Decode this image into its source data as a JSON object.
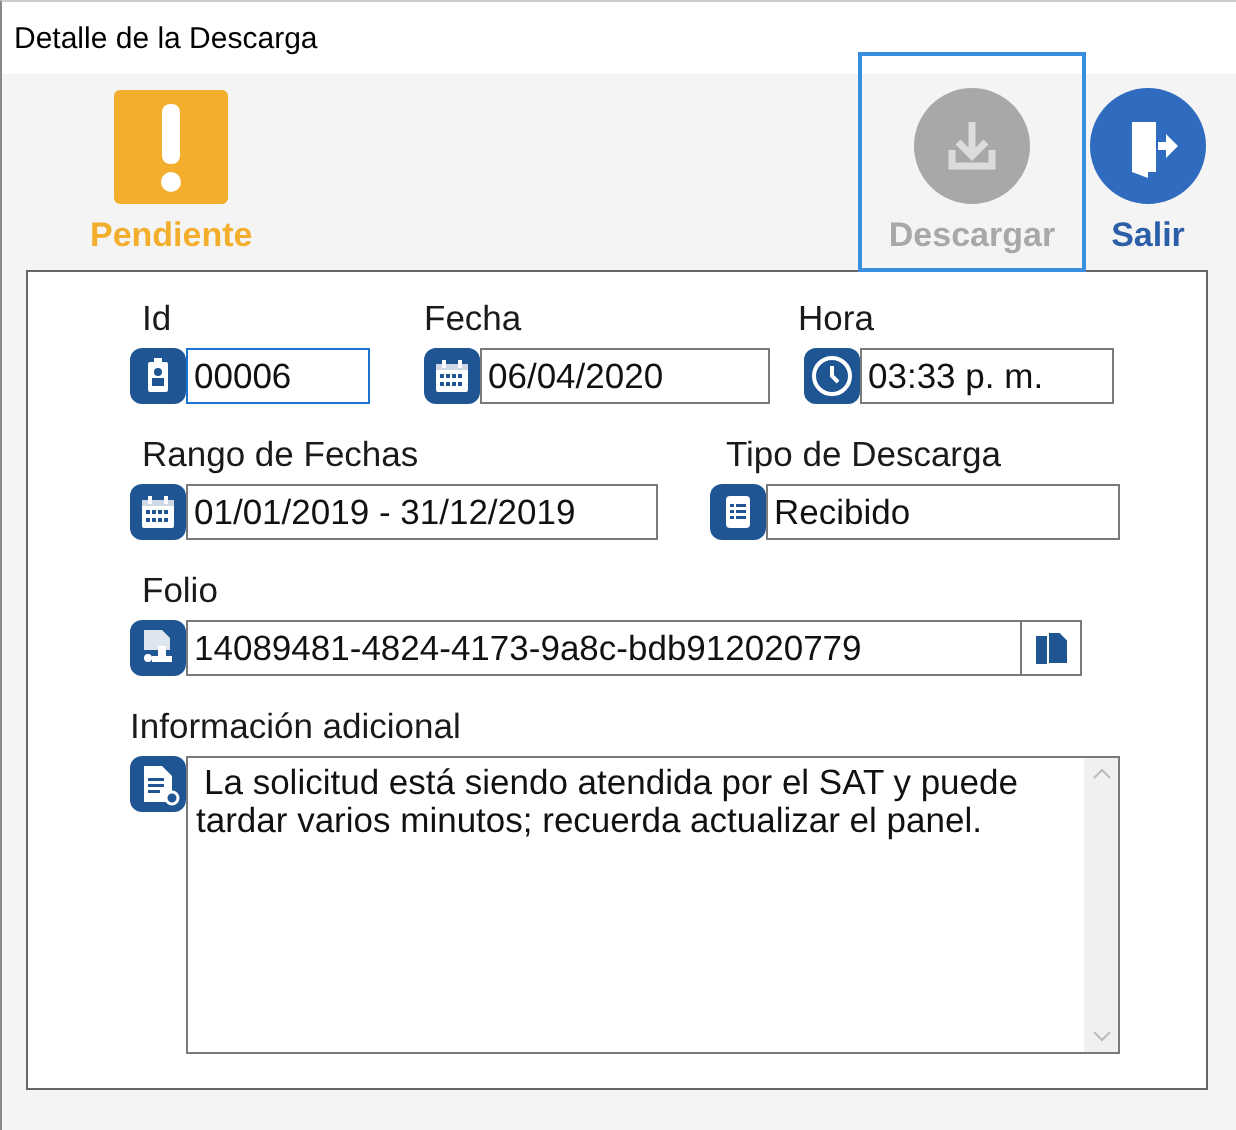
{
  "window": {
    "title": "Detalle de la Descarga"
  },
  "status": {
    "label": "Pendiente",
    "kind": "pending"
  },
  "toolbar": [
    {
      "label": "Descargar",
      "kind": "download",
      "disabled": true,
      "focused": true
    },
    {
      "label": "Salir",
      "kind": "exit",
      "disabled": false,
      "focused": false
    }
  ],
  "fields": [
    {
      "label": "Id",
      "value": "00006",
      "kind": "text",
      "focused": true
    },
    {
      "label": "Fecha",
      "value": "06/04/2020",
      "kind": "text",
      "focused": false
    },
    {
      "label": "Hora",
      "value": "03:33 p. m.",
      "kind": "text",
      "focused": false
    },
    {
      "label": "Rango de Fechas",
      "value": "01/01/2019 - 31/12/2019",
      "kind": "text",
      "focused": false
    },
    {
      "label": "Tipo de Descarga",
      "value": "Recibido",
      "kind": "text",
      "focused": false
    },
    {
      "label": "Folio",
      "value": "14089481-4824-4173-9a8c-bdb912020779",
      "kind": "copy",
      "focused": false
    },
    {
      "label": "Información adicional",
      "value": "La solicitud está siendo atendida por el SAT y puede tardar varios minutos; recuerda actualizar el panel.",
      "kind": "multiline",
      "focused": false
    }
  ]
}
